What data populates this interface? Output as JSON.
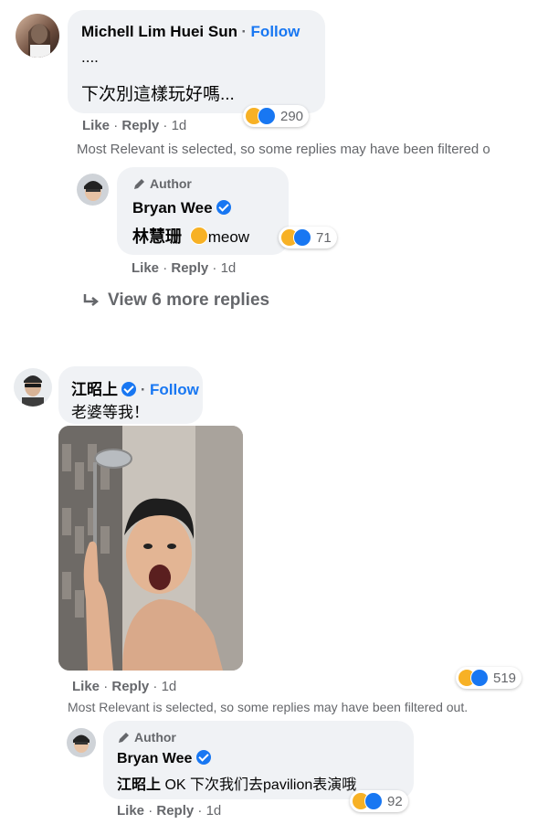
{
  "comment1": {
    "author": "Michell Lim Huei Sun",
    "follow": "Follow",
    "sep": "·",
    "line1": "....",
    "line2": "下次別這樣玩好嗎...",
    "like": "Like",
    "reply": "Reply",
    "time": "1d",
    "reaction_count": "290",
    "notice": "Most Relevant is selected, so some replies may have been filtered o"
  },
  "reply1": {
    "badge": "Author",
    "author": "Bryan Wee",
    "mention": "林慧珊",
    "text": "meow",
    "like": "Like",
    "reply": "Reply",
    "time": "1d",
    "reaction_count": "71"
  },
  "view_more": "View 6 more replies",
  "comment2": {
    "author": "江昭上",
    "follow": "Follow",
    "sep": "·",
    "text": "老婆等我！",
    "like": "Like",
    "reply": "Reply",
    "time": "1d",
    "reaction_count": "519",
    "notice": "Most Relevant is selected, so some replies may have been filtered out."
  },
  "reply2": {
    "badge": "Author",
    "author": "Bryan Wee",
    "mention": "江昭上",
    "text": " OK 下次我们去pavilion表演哦",
    "like": "Like",
    "reply": "Reply",
    "time": "1d",
    "reaction_count": "92"
  },
  "icons": {
    "haha": "haha-emoji",
    "care": "care-emoji",
    "verified": "verified-badge",
    "pencil": "pencil-icon",
    "reply_arrow": "reply-arrow-icon"
  },
  "colors": {
    "link": "#1877f2",
    "bubble": "#f0f2f5",
    "meta": "#65676b"
  }
}
